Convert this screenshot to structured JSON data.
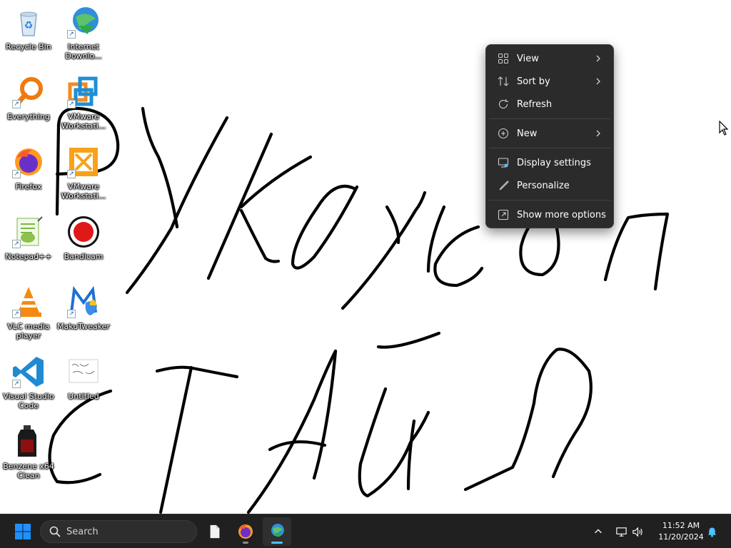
{
  "desktop": {
    "icons": [
      {
        "label": "Recycle Bin",
        "icon": "recycle-bin-icon"
      },
      {
        "label": "Internet Downlo...",
        "icon": "internet-download-manager-icon"
      },
      {
        "label": "Everything",
        "icon": "everything-search-icon"
      },
      {
        "label": "VMware Workstati...",
        "icon": "vmware-workstation-icon"
      },
      {
        "label": "Firefox",
        "icon": "firefox-icon"
      },
      {
        "label": "VMware Workstati...",
        "icon": "vmware-player-icon"
      },
      {
        "label": "Notepad++",
        "icon": "notepad-plus-plus-icon"
      },
      {
        "label": "Bandicam",
        "icon": "bandicam-icon"
      },
      {
        "label": "VLC media player",
        "icon": "vlc-icon"
      },
      {
        "label": "MakuTweaker",
        "icon": "makutweaker-icon"
      },
      {
        "label": "Visual Studio Code",
        "icon": "vscode-icon"
      },
      {
        "label": "Untitled",
        "icon": "untitled-image-icon"
      },
      {
        "label": "Benzene x64 Clean",
        "icon": "benzene-icon"
      }
    ]
  },
  "context_menu": {
    "items": [
      {
        "label": "View",
        "icon": "view-grid-icon",
        "submenu": true
      },
      {
        "label": "Sort by",
        "icon": "sort-icon",
        "submenu": true
      },
      {
        "label": "Refresh",
        "icon": "refresh-icon",
        "submenu": false
      },
      {
        "label": "New",
        "icon": "new-plus-icon",
        "submenu": true
      },
      {
        "label": "Display settings",
        "icon": "display-settings-icon",
        "submenu": false
      },
      {
        "label": "Personalize",
        "icon": "personalize-brush-icon",
        "submenu": false
      },
      {
        "label": "Show more options",
        "icon": "show-more-options-icon",
        "submenu": false
      }
    ]
  },
  "taskbar": {
    "start_icon": "windows-start-icon",
    "search_placeholder": "Search",
    "pinned": [
      {
        "icon": "file-explorer-icon",
        "running": false
      },
      {
        "icon": "firefox-icon",
        "running": true
      },
      {
        "icon": "internet-download-manager-icon",
        "running": true,
        "active": true
      }
    ],
    "tray": {
      "overflow_icon": "chevron-up-icon",
      "network_icon": "network-icon",
      "volume_icon": "volume-icon",
      "time": "11:52 AM",
      "date": "11/20/2024",
      "notification_icon": "notification-bell-icon"
    }
  },
  "colors": {
    "taskbar_bg": "#202020",
    "menu_bg": "#2b2b2b",
    "accent": "#4cc2ff",
    "windows_blue": "#1e90ff"
  }
}
